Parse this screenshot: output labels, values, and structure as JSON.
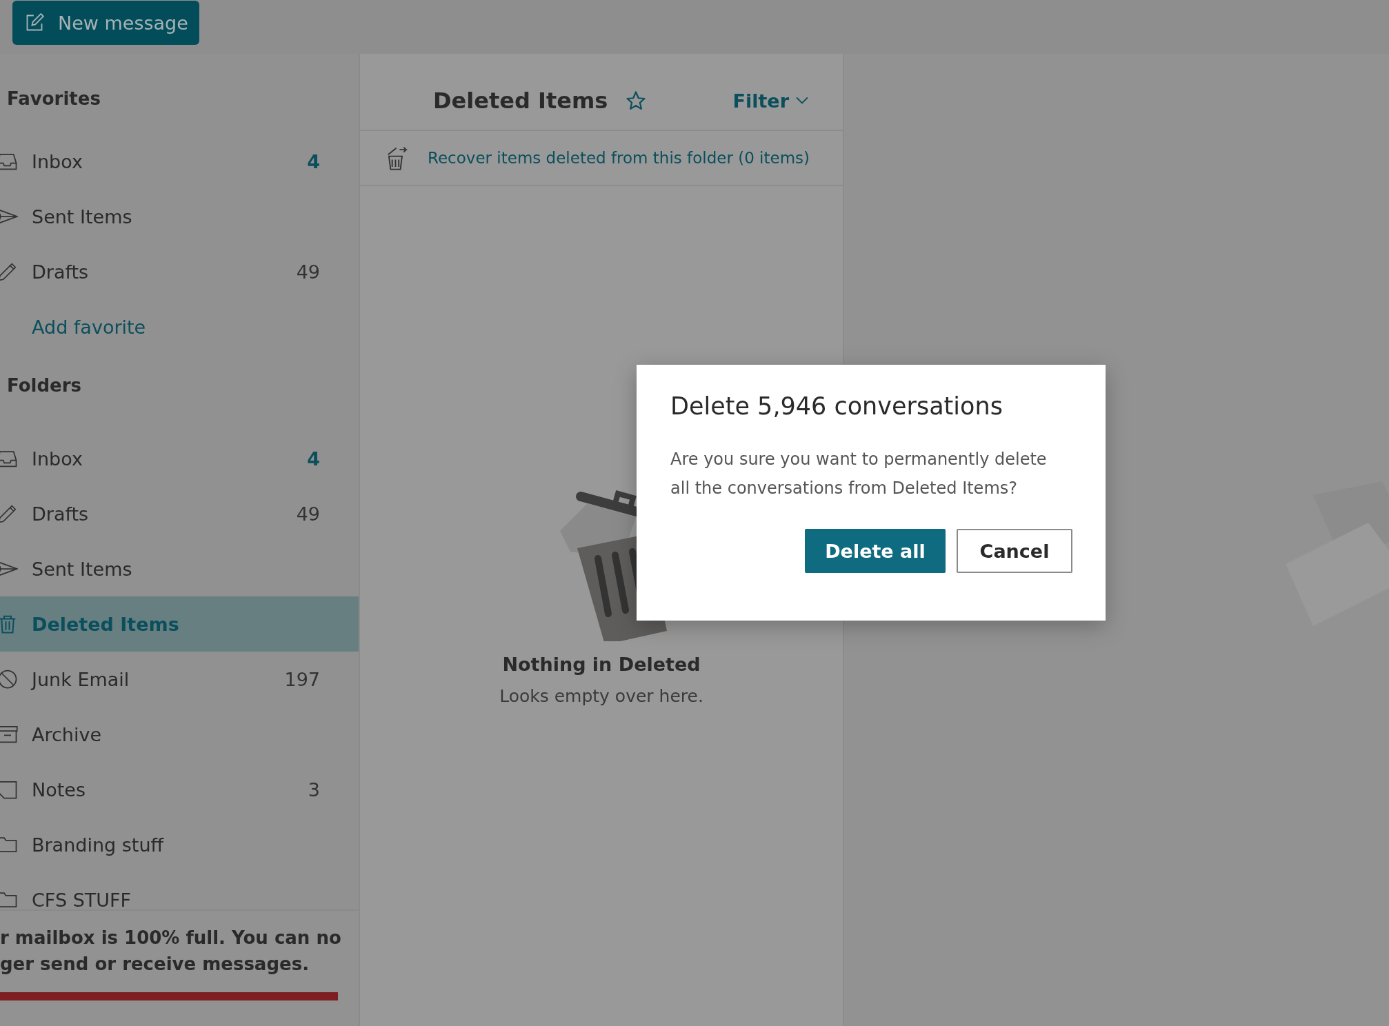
{
  "top_bar": {
    "new_message_button": "New message"
  },
  "sidebar": {
    "favorites": {
      "heading": "Favorites",
      "items": [
        {
          "label": "Inbox",
          "kind": "inbox",
          "count": "4",
          "unread": true,
          "selected": false
        },
        {
          "label": "Sent Items",
          "kind": "sent",
          "selected": false
        },
        {
          "label": "Drafts",
          "kind": "drafts",
          "count": "49",
          "unread": false,
          "selected": false
        }
      ],
      "add_link": "Add favorite"
    },
    "folders": {
      "heading": "Folders",
      "items": [
        {
          "label": "Inbox",
          "kind": "inbox",
          "count": "4",
          "unread": true,
          "selected": false
        },
        {
          "label": "Drafts",
          "kind": "drafts",
          "count": "49",
          "unread": false,
          "selected": false
        },
        {
          "label": "Sent Items",
          "kind": "sent",
          "selected": false
        },
        {
          "label": "Deleted Items",
          "kind": "deleted",
          "selected": true
        },
        {
          "label": "Junk Email",
          "kind": "junk",
          "count": "197",
          "unread": false,
          "selected": false
        },
        {
          "label": "Archive",
          "kind": "archive",
          "selected": false
        },
        {
          "label": "Notes",
          "kind": "notes",
          "count": "3",
          "unread": false,
          "selected": false
        },
        {
          "label": "Branding stuff",
          "kind": "folder",
          "selected": false
        },
        {
          "label": "CFS STUFF",
          "kind": "folder",
          "selected": false
        }
      ]
    },
    "storage": {
      "lines": [
        "r mailbox is 100% full. You can no",
        "ger send or receive messages."
      ],
      "level": 1
    }
  },
  "message_list": {
    "title": "Deleted Items",
    "filter": "Filter",
    "recover_link": "Recover items deleted from this folder (0 items)",
    "empty_state": {
      "title": "Nothing in Deleted",
      "subtitle": "Looks empty over here."
    }
  },
  "dialog": {
    "title": "Delete 5,946 conversations",
    "body": [
      "Are you sure you want to permanently delete",
      "all the conversations from Deleted Items?"
    ],
    "buttons": [
      {
        "label": "Delete all",
        "kind": "primary"
      },
      {
        "label": "Cancel",
        "kind": "secondary"
      }
    ]
  }
}
